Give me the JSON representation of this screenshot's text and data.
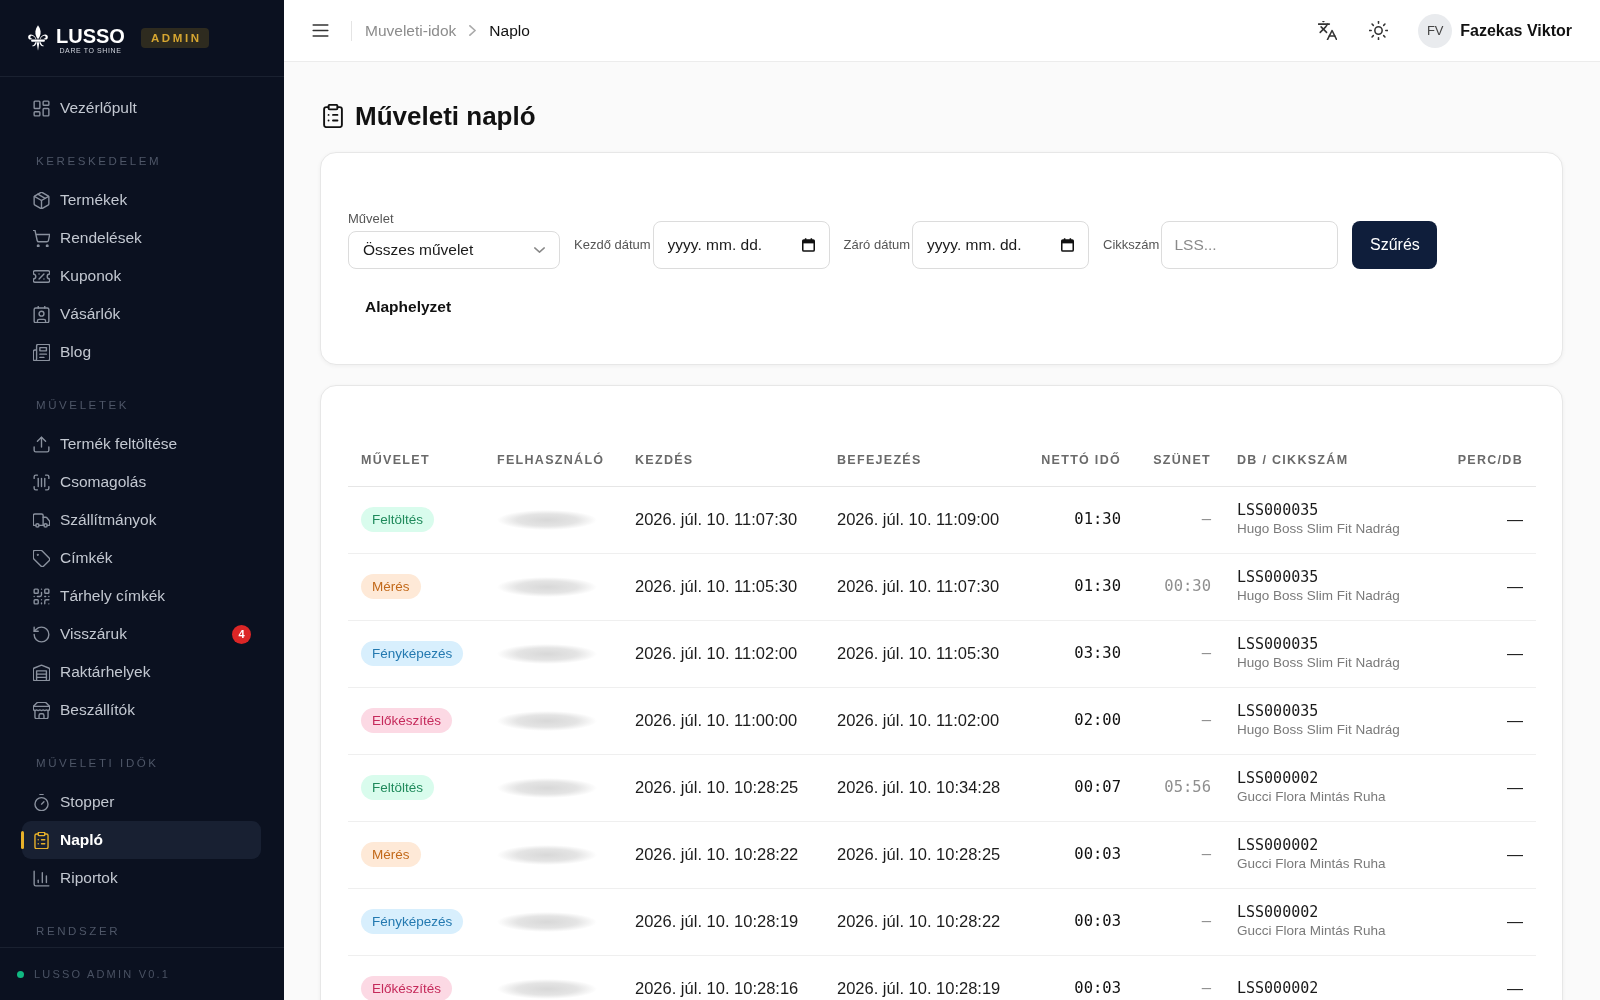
{
  "sidebar": {
    "logo": {
      "wordmark": "LUSSO",
      "tagline": "DARE TO SHINE",
      "badge": "ADMIN"
    },
    "sections": [
      {
        "items": [
          {
            "label": "Vezérlőpult",
            "selected": false
          }
        ]
      },
      {
        "title": "KERESKEDELEM",
        "items": [
          {
            "label": "Termékek",
            "selected": false
          },
          {
            "label": "Rendelések",
            "selected": false
          },
          {
            "label": "Kuponok",
            "selected": false
          },
          {
            "label": "Vásárlók",
            "selected": false
          },
          {
            "label": "Blog",
            "selected": false
          }
        ]
      },
      {
        "title": "MŰVELETEK",
        "items": [
          {
            "label": "Termék feltöltése",
            "selected": false
          },
          {
            "label": "Csomagolás",
            "selected": false
          },
          {
            "label": "Szállítmányok",
            "selected": false
          },
          {
            "label": "Címkék",
            "selected": false
          },
          {
            "label": "Tárhely címkék",
            "selected": false
          },
          {
            "label": "Visszáruk",
            "selected": false,
            "badge": "4"
          },
          {
            "label": "Raktárhelyek",
            "selected": false
          },
          {
            "label": "Beszállítók",
            "selected": false
          }
        ]
      },
      {
        "title": "MŰVELETI IDŐK",
        "items": [
          {
            "label": "Stopper",
            "selected": false
          },
          {
            "label": "Napló",
            "selected": true
          },
          {
            "label": "Riportok",
            "selected": false
          }
        ]
      },
      {
        "title": "RENDSZER"
      }
    ],
    "footer": {
      "online": true,
      "version": "LUSSO ADMIN V0.1"
    }
  },
  "topbar": {
    "breadcrumb": [
      {
        "label": "Muveleti-idok",
        "current": false
      },
      {
        "label": "Naplo",
        "current": true
      }
    ],
    "user": {
      "initials": "FV",
      "name": "Fazekas Viktor"
    }
  },
  "page_title": "Műveleti napló",
  "filters": {
    "fields": [
      {
        "kind": "select",
        "label": "Művelet",
        "value": "Összes művelet"
      },
      {
        "kind": "date",
        "label": "Kezdő dátum",
        "placeholder": "yyyy. mm. dd."
      },
      {
        "kind": "date",
        "label": "Záró dátum",
        "placeholder": "yyyy. mm. dd."
      },
      {
        "kind": "text",
        "label": "Cikkszám",
        "placeholder": "LSS..."
      }
    ],
    "submit_button": "Szűrés",
    "reset_button": "Alaphelyzet"
  },
  "table": {
    "columns": [
      "MŰVELET",
      "FELHASZNÁLÓ",
      "KEZDÉS",
      "BEFEJEZÉS",
      "NETTÓ IDŐ",
      "SZÜNET",
      "DB / CIKKSZÁM",
      "PERC/DB"
    ],
    "rows": [
      {
        "operation": {
          "label": "Feltöltés",
          "color": "#1f8a5b"
        },
        "user_redacted": true,
        "start": "2026. júl. 10. 11:07:30",
        "end": "2026. júl. 10. 11:09:00",
        "net_time": "01:30",
        "pause": "–",
        "sku": "LSS000035",
        "product": "Hugo Boss Slim Fit Nadrág",
        "per_unit": "—"
      },
      {
        "operation": {
          "label": "Mérés",
          "color": "#c2691a"
        },
        "user_redacted": true,
        "start": "2026. júl. 10. 11:05:30",
        "end": "2026. júl. 10. 11:07:30",
        "net_time": "01:30",
        "pause": "00:30",
        "sku": "LSS000035",
        "product": "Hugo Boss Slim Fit Nadrág",
        "per_unit": "—"
      },
      {
        "operation": {
          "label": "Fényképezés",
          "color": "#2379b0"
        },
        "user_redacted": true,
        "start": "2026. júl. 10. 11:02:00",
        "end": "2026. júl. 10. 11:05:30",
        "net_time": "03:30",
        "pause": "–",
        "sku": "LSS000035",
        "product": "Hugo Boss Slim Fit Nadrág",
        "per_unit": "—"
      },
      {
        "operation": {
          "label": "Előkészítés",
          "color": "#c52a5b"
        },
        "user_redacted": true,
        "start": "2026. júl. 10. 11:00:00",
        "end": "2026. júl. 10. 11:02:00",
        "net_time": "02:00",
        "pause": "–",
        "sku": "LSS000035",
        "product": "Hugo Boss Slim Fit Nadrág",
        "per_unit": "—"
      },
      {
        "operation": {
          "label": "Feltöltés",
          "color": "#1f8a5b"
        },
        "user_redacted": true,
        "start": "2026. júl. 10. 10:28:25",
        "end": "2026. júl. 10. 10:34:28",
        "net_time": "00:07",
        "pause": "05:56",
        "sku": "LSS000002",
        "product": "Gucci Flora Mintás Ruha",
        "per_unit": "—"
      },
      {
        "operation": {
          "label": "Mérés",
          "color": "#c2691a"
        },
        "user_redacted": true,
        "start": "2026. júl. 10. 10:28:22",
        "end": "2026. júl. 10. 10:28:25",
        "net_time": "00:03",
        "pause": "–",
        "sku": "LSS000002",
        "product": "Gucci Flora Mintás Ruha",
        "per_unit": "—"
      },
      {
        "operation": {
          "label": "Fényképezés",
          "color": "#2379b0"
        },
        "user_redacted": true,
        "start": "2026. júl. 10. 10:28:19",
        "end": "2026. júl. 10. 10:28:22",
        "net_time": "00:03",
        "pause": "–",
        "sku": "LSS000002",
        "product": "Gucci Flora Mintás Ruha",
        "per_unit": "—"
      },
      {
        "operation": {
          "label": "Előkészítés",
          "color": "#c52a5b"
        },
        "user_redacted": true,
        "start": "2026. júl. 10. 10:28:16",
        "end": "2026. júl. 10. 10:28:19",
        "net_time": "00:03",
        "pause": "–",
        "sku": "LSS000002",
        "per_unit": "—"
      }
    ]
  }
}
